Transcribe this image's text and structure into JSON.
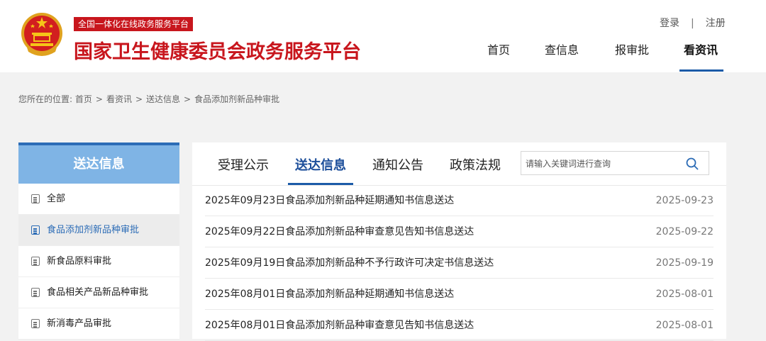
{
  "header": {
    "badge": "全国一体化在线政务服务平台",
    "title": "国家卫生健康委员会政务服务平台",
    "auth": {
      "login": "登录",
      "separator": "|",
      "register": "注册"
    },
    "nav": [
      "首页",
      "查信息",
      "报审批",
      "看资讯"
    ],
    "nav_active": "看资讯"
  },
  "breadcrumb": {
    "prefix": "您所在的位置:",
    "items": [
      "首页",
      "看资讯",
      "送达信息",
      "食品添加剂新品种审批"
    ],
    "separator": ">"
  },
  "sidebar": {
    "heading": "送达信息",
    "items": [
      {
        "label": "全部"
      },
      {
        "label": "食品添加剂新品种审批"
      },
      {
        "label": "新食品原料审批"
      },
      {
        "label": "食品相关产品新品种审批"
      },
      {
        "label": "新消毒产品审批"
      }
    ],
    "active_index": 1
  },
  "tabs": [
    "受理公示",
    "送达信息",
    "通知公告",
    "政策法规"
  ],
  "search": {
    "placeholder": "请输入关键词进行查询"
  },
  "list": [
    {
      "title": "2025年09月23日食品添加剂新品种延期通知书信息送达",
      "date": "2025-09-23"
    },
    {
      "title": "2025年09月22日食品添加剂新品种审查意见告知书信息送达",
      "date": "2025-09-22"
    },
    {
      "title": "2025年09月19日食品添加剂新品种不予行政许可决定书信息送达",
      "date": "2025-09-19"
    },
    {
      "title": "2025年08月01日食品添加剂新品种延期通知书信息送达",
      "date": "2025-08-01"
    },
    {
      "title": "2025年08月01日食品添加剂新品种审查意见告知书信息送达",
      "date": "2025-08-01"
    }
  ],
  "colors": {
    "brand_red": "#c8161d",
    "accent_blue": "#1c5ba8",
    "sidebar_head": "#7fb4e5"
  }
}
